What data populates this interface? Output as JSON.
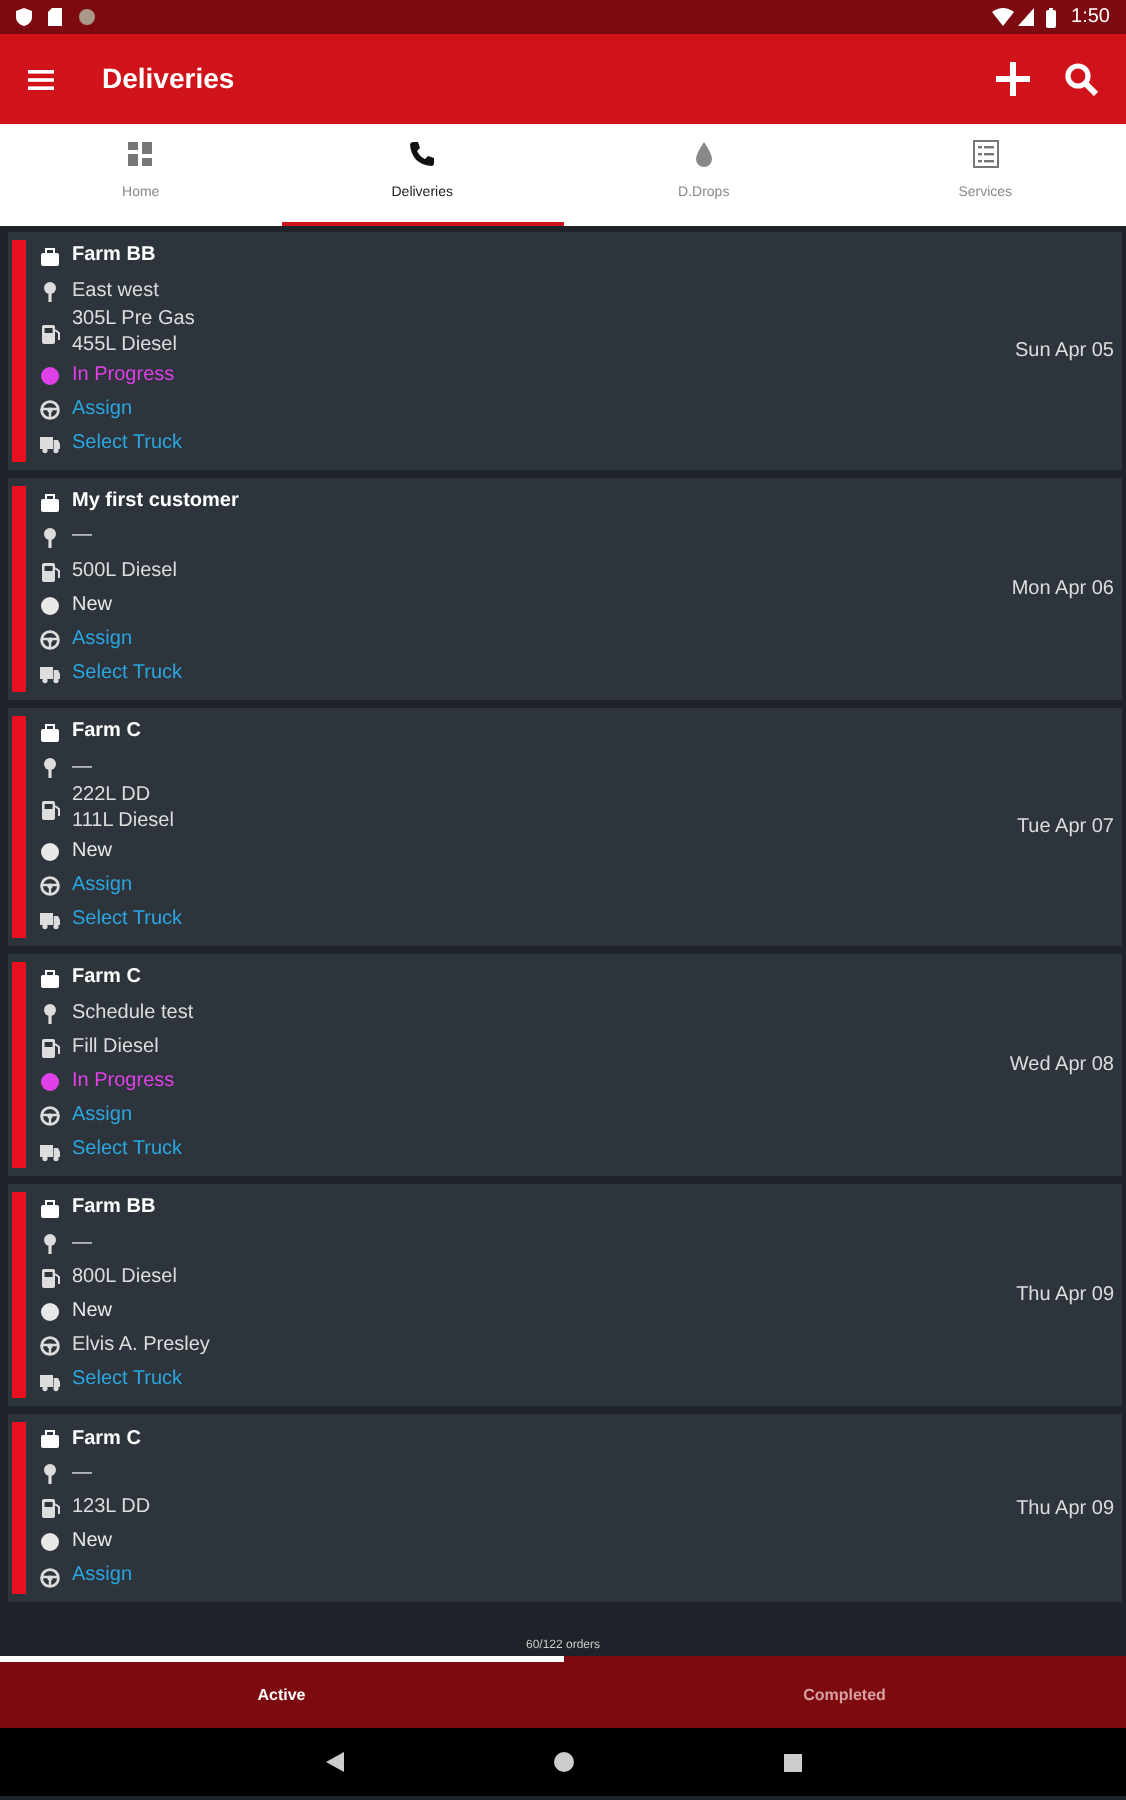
{
  "status_bar": {
    "time": "1:50"
  },
  "app_bar": {
    "title": "Deliveries"
  },
  "tabs": [
    {
      "label": "Home",
      "selected": false
    },
    {
      "label": "Deliveries",
      "selected": true
    },
    {
      "label": "D.Drops",
      "selected": false
    },
    {
      "label": "Services",
      "selected": false
    }
  ],
  "deliveries": [
    {
      "customer": "Farm BB",
      "location": "East west",
      "products": [
        "305L Pre Gas",
        "455L Diesel"
      ],
      "status": {
        "label": "In Progress",
        "color": "#e040e8"
      },
      "driver": {
        "label": "Assign",
        "assigned": false
      },
      "truck": {
        "label": "Select Truck",
        "assigned": false
      },
      "date": "Sun Apr 05"
    },
    {
      "customer": "My first customer",
      "location": "—",
      "products": [
        "500L Diesel"
      ],
      "status": {
        "label": "New",
        "color": "#e8e8e8"
      },
      "driver": {
        "label": "Assign",
        "assigned": false
      },
      "truck": {
        "label": "Select Truck",
        "assigned": false
      },
      "date": "Mon Apr 06"
    },
    {
      "customer": "Farm C",
      "location": "—",
      "products": [
        "222L DD",
        "111L Diesel"
      ],
      "status": {
        "label": "New",
        "color": "#e8e8e8"
      },
      "driver": {
        "label": "Assign",
        "assigned": false
      },
      "truck": {
        "label": "Select Truck",
        "assigned": false
      },
      "date": "Tue Apr 07"
    },
    {
      "customer": "Farm C",
      "location": "Schedule test",
      "products": [
        "Fill Diesel"
      ],
      "status": {
        "label": "In Progress",
        "color": "#e040e8"
      },
      "driver": {
        "label": "Assign",
        "assigned": false
      },
      "truck": {
        "label": "Select Truck",
        "assigned": false
      },
      "date": "Wed Apr 08"
    },
    {
      "customer": "Farm BB",
      "location": "—",
      "products": [
        "800L Diesel"
      ],
      "status": {
        "label": "New",
        "color": "#e8e8e8"
      },
      "driver": {
        "label": "Elvis A. Presley",
        "assigned": true
      },
      "truck": {
        "label": "Select Truck",
        "assigned": false
      },
      "date": "Thu Apr 09"
    },
    {
      "customer": "Farm C",
      "location": "—",
      "products": [
        "123L DD"
      ],
      "status": {
        "label": "New",
        "color": "#e8e8e8"
      },
      "driver": {
        "label": "Assign",
        "assigned": false
      },
      "date": "Thu Apr 09"
    }
  ],
  "footer": {
    "count": "60/122 orders"
  },
  "bottom_tabs": [
    {
      "label": "Active",
      "selected": true
    },
    {
      "label": "Completed",
      "selected": false
    }
  ]
}
